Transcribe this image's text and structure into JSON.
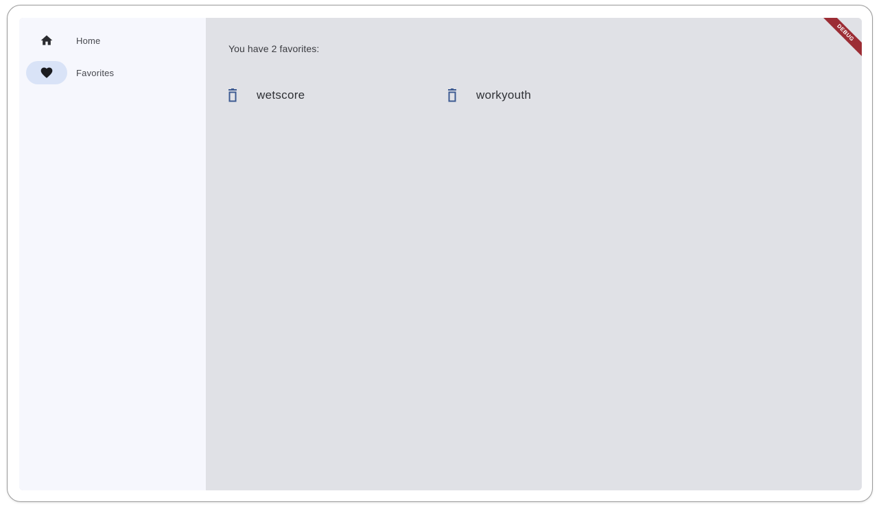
{
  "nav": {
    "items": [
      {
        "label": "Home",
        "icon": "home-icon",
        "selected": false
      },
      {
        "label": "Favorites",
        "icon": "heart-icon",
        "selected": true
      }
    ]
  },
  "favorites": {
    "summary": "You have 2 favorites:",
    "items": [
      {
        "word": "wetscore"
      },
      {
        "word": "workyouth"
      }
    ]
  },
  "debug_banner": {
    "label": "DEBUG",
    "color": "#9c2d35"
  },
  "colors": {
    "nav_background": "#f6f7fd",
    "content_background": "#e0e1e6",
    "selected_indicator": "#d9e3f7",
    "delete_icon": "#3d5a91"
  }
}
